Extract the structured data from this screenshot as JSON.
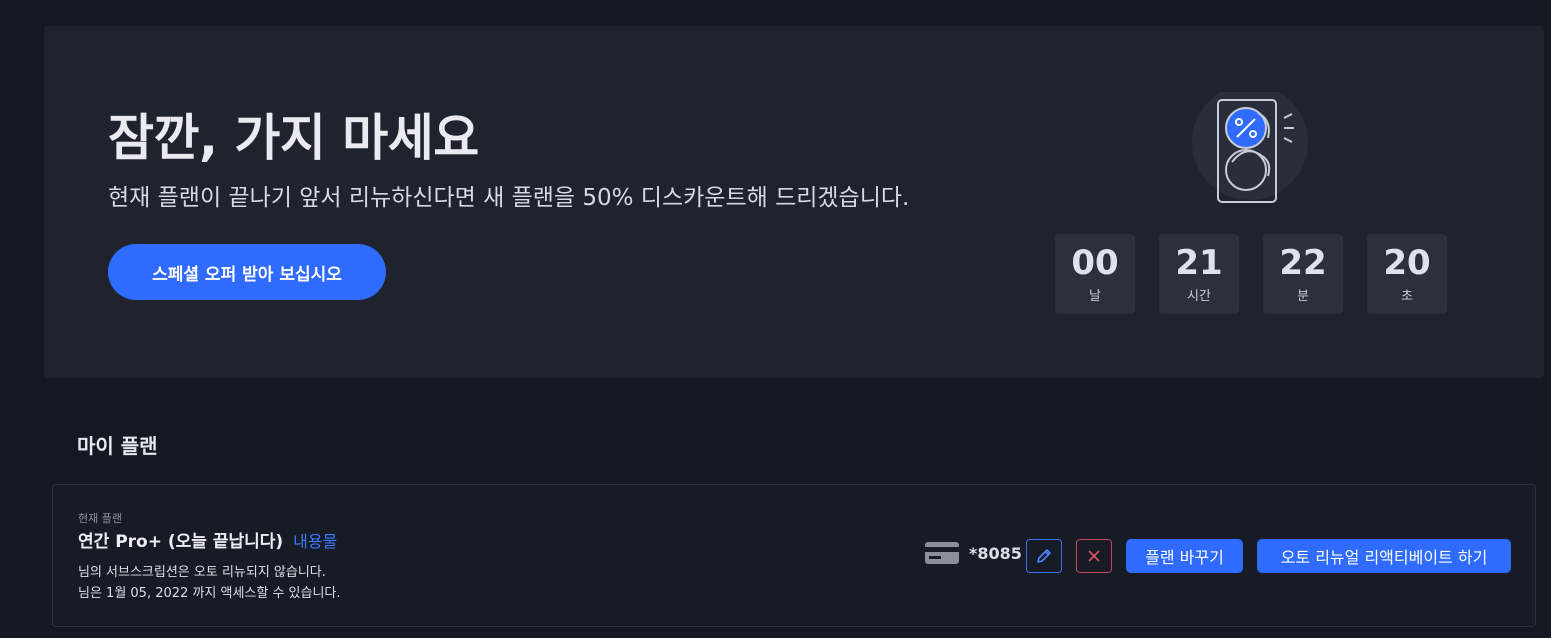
{
  "promo": {
    "title": "잠깐, 가지 마세요",
    "subtitle": "현재 플랜이 끝나기 앞서 리뉴하신다면 새 플랜을 50% 디스카운트해 드리겠습니다.",
    "cta_label": "스페셜 오퍼 받아 보십시오",
    "illustration_icon": "discount-card-icon",
    "countdown": [
      {
        "value": "00",
        "unit": "날"
      },
      {
        "value": "21",
        "unit": "시간"
      },
      {
        "value": "22",
        "unit": "분"
      },
      {
        "value": "20",
        "unit": "초"
      }
    ]
  },
  "my_plan": {
    "section_title": "마이 플랜",
    "current_plan_label": "현재 플랜",
    "plan_name": "연간 Pro+ (오늘 끝납니다)",
    "details_link": "내용물",
    "notice_line1": "님의 서브스크립션은 오토 리뉴되지 않습니다.",
    "notice_line2": "님은 1월 05, 2022 까지 액세스할 수 있습니다.",
    "card_last4": "*8085",
    "change_plan_label": "플랜 바꾸기",
    "reactivate_label": "오토 리뉴얼 리액티베이트 하기"
  },
  "colors": {
    "accent": "#2f6bff",
    "danger": "#c94452",
    "page_bg": "#141823",
    "panel_bg": "#1f232e"
  }
}
